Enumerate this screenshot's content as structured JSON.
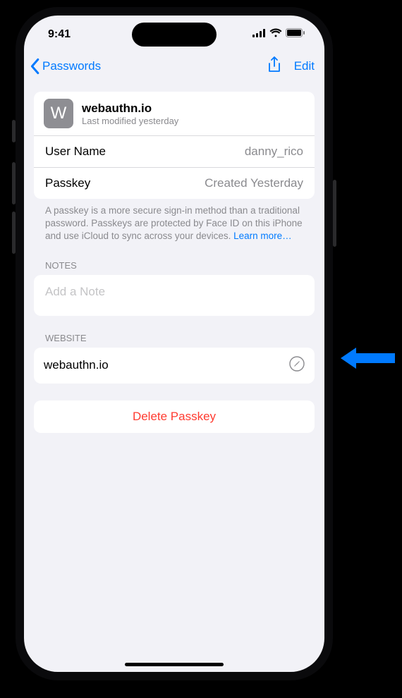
{
  "status": {
    "time": "9:41"
  },
  "nav": {
    "back_label": "Passwords",
    "edit_label": "Edit"
  },
  "site": {
    "icon_letter": "W",
    "title": "webauthn.io",
    "subtitle": "Last modified yesterday"
  },
  "rows": {
    "username_label": "User Name",
    "username_value": "danny_rico",
    "passkey_label": "Passkey",
    "passkey_value": "Created Yesterday"
  },
  "explainer": {
    "text": "A passkey is a more secure sign-in method than a traditional password. Passkeys are protected by Face ID on this iPhone and use iCloud to sync across your devices. ",
    "link": "Learn more…"
  },
  "sections": {
    "notes_header": "NOTES",
    "notes_placeholder": "Add a Note",
    "website_header": "WEBSITE",
    "website_value": "webauthn.io"
  },
  "actions": {
    "delete_label": "Delete Passkey"
  }
}
